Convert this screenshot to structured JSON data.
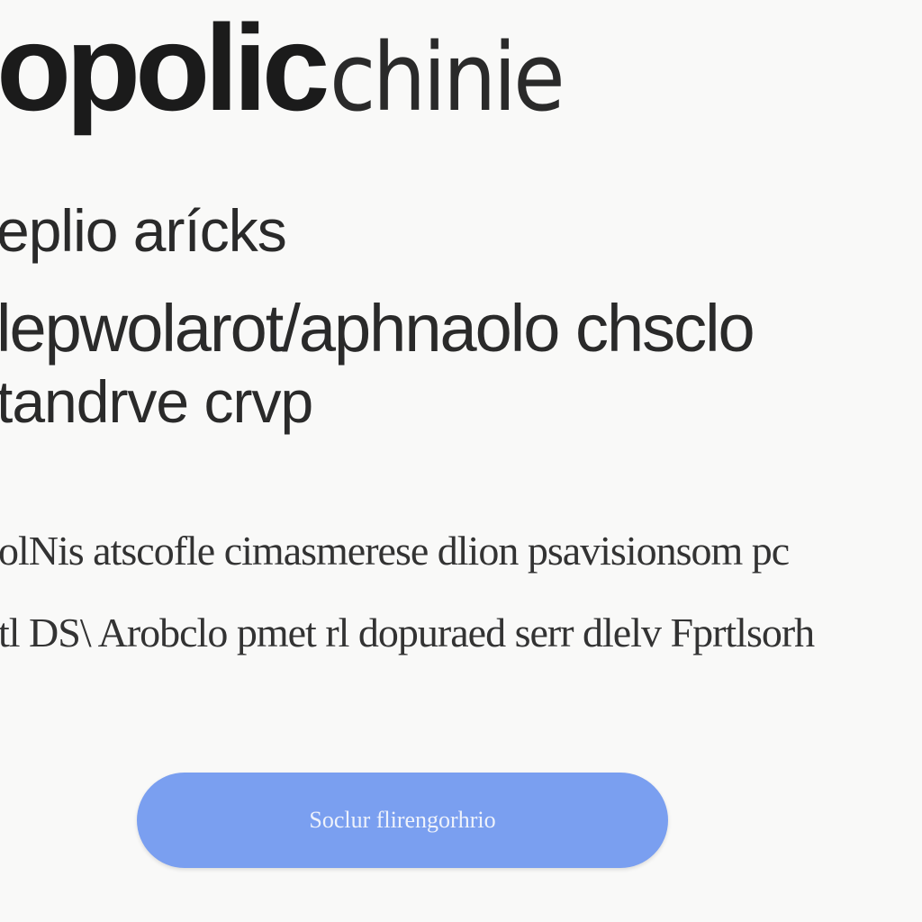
{
  "header": {
    "title_bold": "opolic",
    "title_light": "chinie"
  },
  "headings": [
    "eplio arícks",
    "lepwolarot/aphnaolo chsclo",
    "tandrve crvp"
  ],
  "description": [
    "olNis atscofle cimasmerese dlion psavisionsom pc",
    "tl DS\\ Arobclo pmet rl dopuraed serr dlelv Fprtlsorh"
  ],
  "cta": {
    "label": "Soclur flirengorhrio",
    "color": "#7a9ff0"
  }
}
